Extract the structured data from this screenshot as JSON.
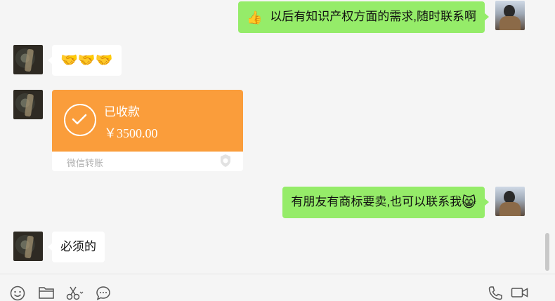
{
  "messages": [
    {
      "side": "right",
      "emoji": "👍",
      "text": "以后有知识产权方面的需求,随时联系啊"
    },
    {
      "side": "left",
      "text": "🤝🤝🤝"
    },
    {
      "side": "left",
      "type": "transfer",
      "status": "已收款",
      "amount": "￥3500.00",
      "source": "微信转账"
    },
    {
      "side": "right",
      "text": "有朋友有商标要卖,也可以联系我",
      "emoji": "😸"
    },
    {
      "side": "left",
      "text": "必须的"
    }
  ],
  "toolbar": {
    "left": [
      "emoji-icon",
      "folder-icon",
      "scissors-icon",
      "chat-bubble-icon"
    ],
    "right": [
      "phone-icon",
      "video-call-icon"
    ]
  },
  "colors": {
    "bubble_green": "#95ec69",
    "transfer_orange": "#fa9d3b",
    "background": "#f5f5f5"
  }
}
